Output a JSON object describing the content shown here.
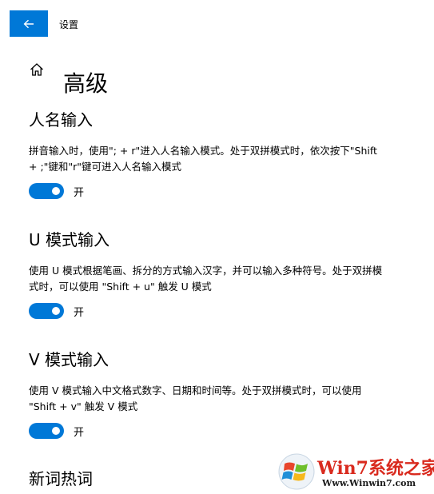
{
  "window": {
    "title": "设置"
  },
  "header": {
    "title": "高级"
  },
  "sections": [
    {
      "title": "人名输入",
      "description": "拼音输入时，使用\"; + r\"进入人名输入模式。处于双拼模式时，依次按下\"Shift + ;\"键和\"r\"键可进入人名输入模式",
      "toggle": {
        "on": true,
        "label": "开"
      }
    },
    {
      "title": "U 模式输入",
      "description": "使用 U 模式根据笔画、拆分的方式输入汉字，并可以输入多种符号。处于双拼模式时，可以使用 \"Shift + u\" 触发 U 模式",
      "toggle": {
        "on": true,
        "label": "开"
      }
    },
    {
      "title": "V 模式输入",
      "description": "使用 V 模式输入中文格式数字、日期和时间等。处于双拼模式时，可以使用 \"Shift + v\" 触发 V 模式",
      "toggle": {
        "on": true,
        "label": "开"
      }
    },
    {
      "title": "新词热词"
    }
  ],
  "watermark": {
    "brand": "Win7系统之家",
    "url": "Www.Winwin7.com"
  },
  "colors": {
    "accent": "#0078d7",
    "toggle_knob": "#ffffff",
    "text": "#000000"
  },
  "icons": {
    "back": "back-arrow-icon",
    "home": "home-icon"
  }
}
